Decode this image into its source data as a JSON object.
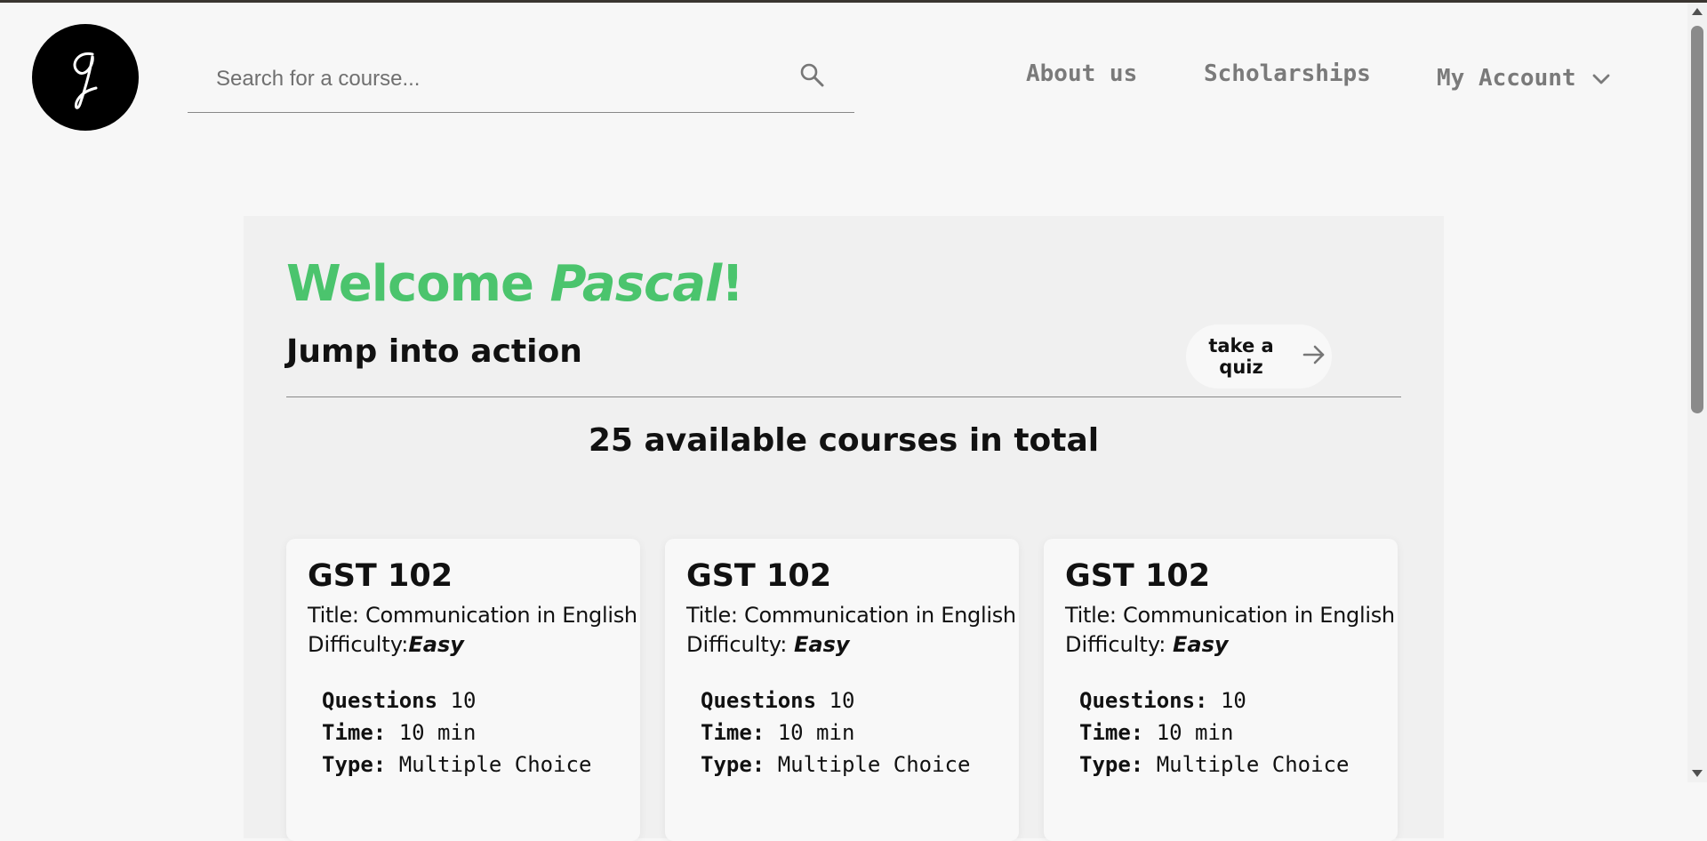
{
  "header": {
    "logo_glyph": "q",
    "search": {
      "placeholder": "Search for a course...",
      "value": ""
    },
    "nav": {
      "about": "About us",
      "scholarships": "Scholarships",
      "account": "My Account"
    }
  },
  "main": {
    "welcome_prefix": "Welcome ",
    "user_name": "Pascal",
    "welcome_suffix": "!",
    "subtitle": "Jump into action",
    "quiz_button": "take a quiz",
    "course_count_text": "25 available courses in total",
    "courses": [
      {
        "code": "GST 102",
        "title": "Title: Communication in English",
        "difficulty_label": "Difficulty:",
        "difficulty": "Easy",
        "questions_label": "Questions",
        "questions": "10",
        "time_label": "Time:",
        "time": "10 min",
        "type_label": "Type:",
        "type": "Multiple Choice"
      },
      {
        "code": "GST 102",
        "title": "Title: Communication in English",
        "difficulty_label": "Difficulty: ",
        "difficulty": "Easy",
        "questions_label": "Questions",
        "questions": "10",
        "time_label": "Time:",
        "time": "10 min",
        "type_label": "Type:",
        "type": "Multiple Choice"
      },
      {
        "code": "GST 102",
        "title": "Title: Communication in English",
        "difficulty_label": "Difficulty: ",
        "difficulty": "Easy",
        "questions_label": "Questions:",
        "questions": "10",
        "time_label": "Time:",
        "time": "10 min",
        "type_label": "Type:",
        "type": "Multiple Choice"
      }
    ]
  },
  "colors": {
    "accent_green": "#4bc46d",
    "nav_gray": "#7a7a7a",
    "panel_bg": "#f0f0f0"
  },
  "icons": {
    "search": "search-icon",
    "account_chevron": "chevron-down-icon",
    "quiz_arrow": "arrow-right-icon"
  }
}
